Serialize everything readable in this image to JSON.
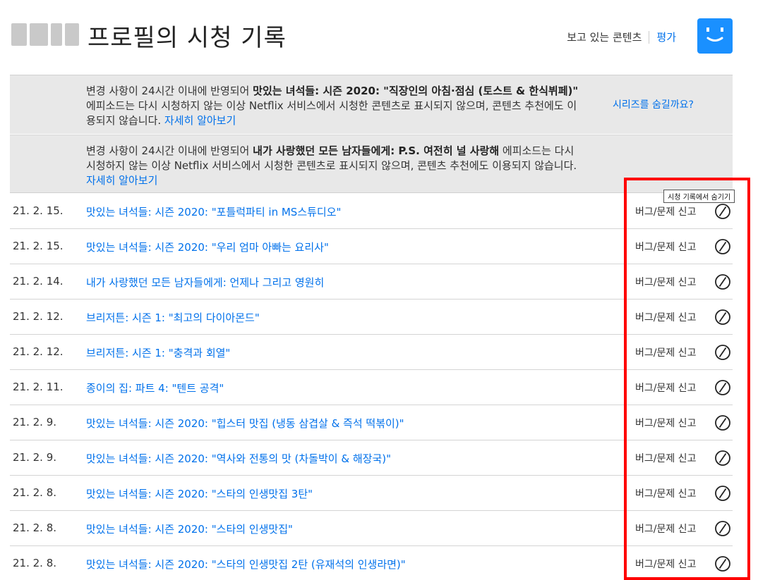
{
  "header": {
    "title": "프로필의 시청 기록",
    "link_viewing": "보고 있는 콘텐츠",
    "link_rating": "평가"
  },
  "notices": [
    {
      "prefix": "변경 사항이 24시간 이내에 반영되어 ",
      "bold": "맛있는 녀석들: 시즌 2020: \"직장인의 아침·점심 (토스트 & 한식뷔페)\"",
      "suffix": " 에피소드는 다시 시청하지 않는 이상 Netflix 서비스에서 시청한 콘텐츠로 표시되지 않으며, 콘텐츠 추천에도 이용되지 않습니다. ",
      "link": "자세히 알아보기",
      "action": "시리즈를 숨길까요?"
    },
    {
      "prefix": "변경 사항이 24시간 이내에 반영되어 ",
      "bold": "내가 사랑했던 모든 남자들에게: P.S. 여전히 널 사랑해",
      "suffix": " 에피소드는 다시 시청하지 않는 이상 Netflix 서비스에서 시청한 콘텐츠로 표시되지 않으며, 콘텐츠 추천에도 이용되지 않습니다. ",
      "link": "자세히 알아보기"
    }
  ],
  "report_label": "버그/문제 신고",
  "tooltip": "시청 기록에서 숨기기",
  "history": [
    {
      "date": "21. 2. 15.",
      "title": "맛있는 녀석들: 시즌 2020: \"포틀럭파티 in MS스튜디오\""
    },
    {
      "date": "21. 2. 15.",
      "title": "맛있는 녀석들: 시즌 2020: \"우리 엄마 아빠는 요리사\""
    },
    {
      "date": "21. 2. 14.",
      "title": "내가 사랑했던 모든 남자들에게: 언제나 그리고 영원히"
    },
    {
      "date": "21. 2. 12.",
      "title": "브리저튼: 시즌 1: \"최고의 다이아몬드\""
    },
    {
      "date": "21. 2. 12.",
      "title": "브리저튼: 시즌 1: \"충격과 회열\""
    },
    {
      "date": "21. 2. 11.",
      "title": "종이의 집: 파트 4: \"텐트 공격\""
    },
    {
      "date": "21. 2. 9.",
      "title": "맛있는 녀석들: 시즌 2020: \"힙스터 맛집 (냉동 삼겹살 & 즉석 떡볶이)\""
    },
    {
      "date": "21. 2. 9.",
      "title": "맛있는 녀석들: 시즌 2020: \"역사와 전통의 맛 (차돌박이 & 해장국)\""
    },
    {
      "date": "21. 2. 8.",
      "title": "맛있는 녀석들: 시즌 2020: \"스타의 인생맛집 3탄\""
    },
    {
      "date": "21. 2. 8.",
      "title": "맛있는 녀석들: 시즌 2020: \"스타의 인생맛집\""
    },
    {
      "date": "21. 2. 8.",
      "title": "맛있는 녀석들: 시즌 2020: \"스타의 인생맛집 2탄 (유재석의 인생라면)\""
    }
  ],
  "colors": {
    "link": "#0071eb",
    "notice_bg": "#e8e8e8",
    "avatar": "#1a90ff",
    "highlight": "#ff0000"
  },
  "icons": {
    "avatar": "smiley-face-icon",
    "hide": "circle-slash-icon"
  }
}
